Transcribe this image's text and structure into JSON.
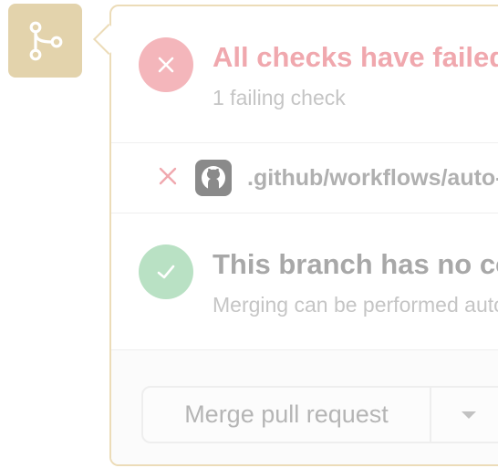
{
  "colors": {
    "badge_bg": "#e3d3ac",
    "panel_border": "#ecdcb8",
    "fail_circle": "#f4b6bb",
    "fail_text": "#f0a8ae",
    "success_circle": "#b9e1c4",
    "muted_text": "#c5c5c5"
  },
  "branch_badge": {
    "icon": "git-branch-icon"
  },
  "checks": {
    "status_icon": "x-icon",
    "title": "All checks have failed",
    "subtitle": "1 failing check"
  },
  "workflow": {
    "status_icon": "x-icon",
    "avatar_icon": "github-icon",
    "name": ".github/workflows/auto-merge.yml"
  },
  "conflicts": {
    "status_icon": "check-icon",
    "title": "This branch has no conflicts with the base branch",
    "subtitle": "Merging can be performed automatically."
  },
  "merge": {
    "button_label": "Merge pull request",
    "dropdown_icon": "triangle-down-icon"
  }
}
